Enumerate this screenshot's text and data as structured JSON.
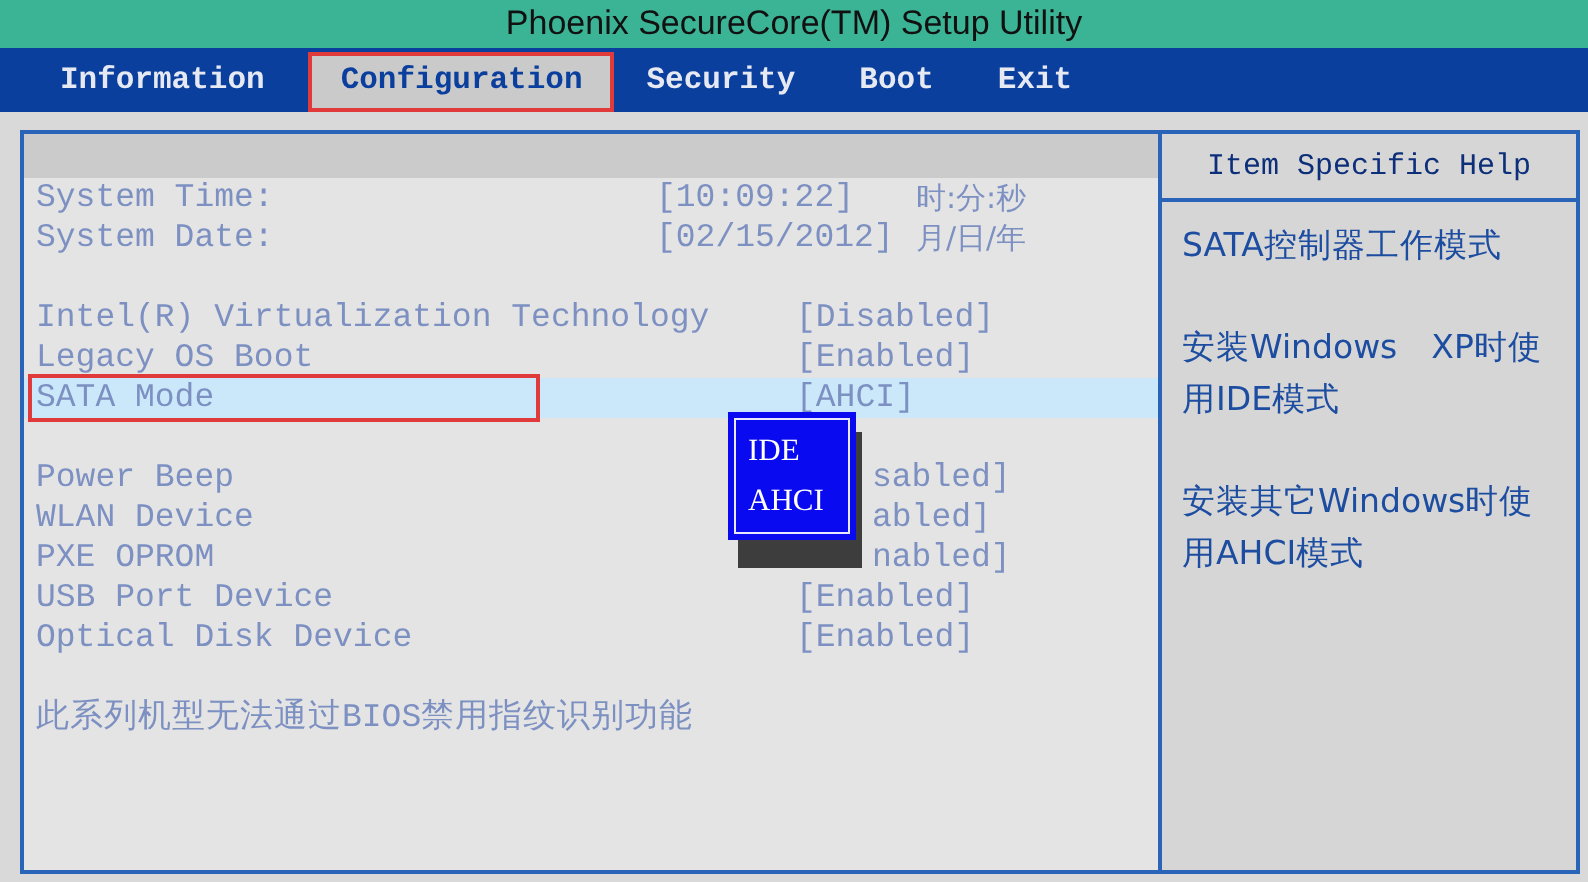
{
  "window": {
    "title": "Phoenix SecureCore(TM) Setup Utility"
  },
  "tabs": [
    {
      "label": "Information",
      "selected": false
    },
    {
      "label": "Configuration",
      "selected": true
    },
    {
      "label": "Security",
      "selected": false
    },
    {
      "label": "Boot",
      "selected": false
    },
    {
      "label": "Exit",
      "selected": false
    }
  ],
  "settings": {
    "groups": [
      [
        {
          "kind": "datetime",
          "label": "System Time:",
          "value": "[10:09:22]",
          "note": "时:分:秒",
          "selected": false
        },
        {
          "kind": "datetime",
          "label": "System Date:",
          "value": "[02/15/2012]",
          "note": "月/日/年",
          "selected": false
        }
      ],
      [
        {
          "kind": "option",
          "label": "Intel(R) Virtualization Technology",
          "value": "[Disabled]",
          "selected": false,
          "covered": false
        },
        {
          "kind": "option",
          "label": "Legacy OS Boot",
          "value": "[Enabled]",
          "selected": false,
          "covered": false
        },
        {
          "kind": "option",
          "label": "SATA Mode",
          "value": "[AHCI]",
          "selected": true,
          "covered": false
        }
      ],
      [
        {
          "kind": "option",
          "label": "Power Beep",
          "value": "sabled]",
          "selected": false,
          "covered": true
        },
        {
          "kind": "option",
          "label": "WLAN Device",
          "value": "abled]",
          "selected": false,
          "covered": true
        },
        {
          "kind": "option",
          "label": "PXE OPROM",
          "value": "nabled]",
          "selected": false,
          "covered": true
        },
        {
          "kind": "option",
          "label": "USB Port Device",
          "value": "[Enabled]",
          "selected": false,
          "covered": false
        },
        {
          "kind": "option",
          "label": "Optical Disk Device",
          "value": "[Enabled]",
          "selected": false,
          "covered": false
        }
      ]
    ],
    "note": "此系列机型无法通过BIOS禁用指纹识别功能"
  },
  "popup": {
    "options": [
      "IDE",
      "AHCI"
    ]
  },
  "help": {
    "title": "Item Specific Help",
    "paragraphs": [
      "SATA控制器工作模式",
      "安装Windows　XP时使用IDE模式",
      "安装其它Windows时使用AHCI模式"
    ]
  }
}
